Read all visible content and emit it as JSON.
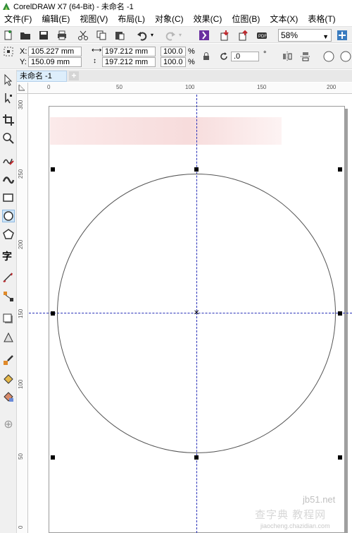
{
  "window": {
    "title": "CorelDRAW X7 (64-Bit) - 未命名 -1"
  },
  "menu": [
    "文件(F)",
    "编辑(E)",
    "视图(V)",
    "布局(L)",
    "对象(C)",
    "效果(C)",
    "位图(B)",
    "文本(X)",
    "表格(T)"
  ],
  "toolbar": {
    "zoom_value": "58%",
    "icons": [
      "new-icon",
      "open-icon",
      "save-icon",
      "print-icon",
      "cut-icon",
      "copy-icon",
      "paste-icon",
      "undo-icon",
      "redo-icon",
      "search-content-icon",
      "import-icon",
      "export-icon",
      "publish-pdf-icon",
      "app-launcher-icon"
    ]
  },
  "property_bar": {
    "x_label": "X:",
    "x_value": "105.227 mm",
    "y_label": "Y:",
    "y_value": "150.09 mm",
    "width_value": "197.212 mm",
    "height_value": "197.212 mm",
    "scale_x": "100.0",
    "scale_y": "100.0",
    "percent": "%",
    "rotation": ".0",
    "degree": "°"
  },
  "document_tab": {
    "label": "未命名 -1",
    "add": "+"
  },
  "ruler_top": {
    "unit": "毫米",
    "labels": [
      "0",
      "50",
      "100",
      "150",
      "200"
    ]
  },
  "ruler_left": {
    "labels": [
      "300",
      "250",
      "200",
      "150",
      "100",
      "50",
      "0"
    ]
  },
  "watermark": {
    "site": "jb51.net",
    "big": "查字典 教程网",
    "small": "jiaocheng.chazidian.com"
  }
}
